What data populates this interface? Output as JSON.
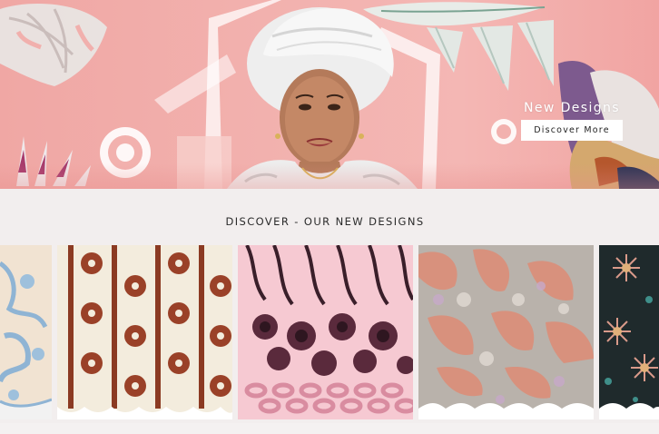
{
  "hero": {
    "title": "New Designs",
    "button_label": "Discover More",
    "background_color": "#f2b1ae"
  },
  "section": {
    "heading": "DISCOVER - OUR NEW DESIGNS"
  },
  "carousel": {
    "items": [
      {
        "name": "blue-lace-fabric",
        "colors": [
          "#f1e3d2",
          "#8fb4d4"
        ]
      },
      {
        "name": "brown-flower-stripe-lace",
        "colors": [
          "#f3ecdd",
          "#8b3a22"
        ]
      },
      {
        "name": "pink-black-floral-lace",
        "colors": [
          "#f6c9d2",
          "#3a1f2a"
        ]
      },
      {
        "name": "peach-grey-cord-lace",
        "colors": [
          "#b9b2ab",
          "#d8917d"
        ]
      },
      {
        "name": "black-pink-sequin-lace",
        "colors": [
          "#1f2a2c",
          "#d99a8a"
        ]
      }
    ]
  }
}
